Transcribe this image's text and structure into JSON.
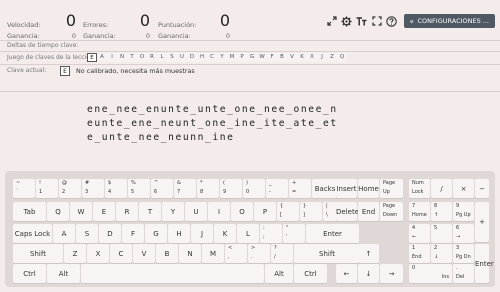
{
  "stats": {
    "speed_label": "Velocidad:",
    "speed_value": "0",
    "speed_gain_label": "Ganancia:",
    "speed_gain": "0",
    "errors_label": "Errores:",
    "errors_value": "0",
    "errors_gain_label": "Ganancia:",
    "errors_gain": "0",
    "score_label": "Puntuación:",
    "score_value": "0",
    "score_gain_label": "Ganancia:",
    "score_gain": "0"
  },
  "toolbar": {
    "config_label": "CONFIGURACIONES ..."
  },
  "info": {
    "delta_label": "Deltas de tiempo clave:",
    "lesson_keys_label": "Juego de claves de la lección:",
    "lesson_keys": [
      "E",
      "A",
      "I",
      "N",
      "T",
      "O",
      "R",
      "L",
      "S",
      "U",
      "D",
      "H",
      "C",
      "Y",
      "M",
      "P",
      "G",
      "W",
      "F",
      "B",
      "V",
      "K",
      "X",
      "J",
      "Z",
      "Q"
    ],
    "current_key_label": "Clave actual:",
    "current_key": "E",
    "current_msg": "No calibrado, necesita más muestras"
  },
  "practice": {
    "line1": "ene_nee_enunte_unte_one_nee_onee_n",
    "line2": "eunte_ene_neunt_one_ine_ite_ate_et",
    "line3": "e_unte_nee_neunn_ine"
  },
  "keyboard": {
    "row1": [
      [
        "~",
        "`"
      ],
      [
        "!",
        "1"
      ],
      [
        "@",
        "2"
      ],
      [
        "#",
        "3"
      ],
      [
        "$",
        "4"
      ],
      [
        "%",
        "5"
      ],
      [
        "^",
        "6"
      ],
      [
        "&",
        "7"
      ],
      [
        "*",
        "8"
      ],
      [
        "(",
        "9"
      ],
      [
        ")",
        "0"
      ],
      [
        "_",
        "-"
      ],
      [
        "+",
        "="
      ]
    ],
    "backspace": "Backspace",
    "tab": "Tab",
    "row2": [
      "Q",
      "W",
      "E",
      "R",
      "T",
      "Y",
      "U",
      "I",
      "O",
      "P"
    ],
    "row2_sym": [
      [
        "{",
        "["
      ],
      [
        "}",
        "]"
      ],
      [
        "|",
        "\\"
      ]
    ],
    "caps": "Caps Lock",
    "row3": [
      "A",
      "S",
      "D",
      "F",
      "G",
      "H",
      "J",
      "K",
      "L"
    ],
    "row3_sym": [
      [
        ":",
        ";"
      ],
      [
        "\"",
        "'"
      ]
    ],
    "enter": "Enter",
    "shift_l": "Shift",
    "row4": [
      "Z",
      "X",
      "C",
      "V",
      "B",
      "N",
      "M"
    ],
    "row4_sym": [
      [
        "<",
        ","
      ],
      [
        ">",
        "."
      ],
      [
        "?",
        "/"
      ]
    ],
    "shift_r": "Shift",
    "ctrl_l": "Ctrl",
    "alt_l": "Alt",
    "alt_r": "Alt",
    "ctrl_r": "Ctrl",
    "insert": "Insert",
    "home": "Home",
    "page_up_1": "Page",
    "page_up_2": "Up",
    "delete": "Delete",
    "end": "End",
    "page_down_1": "Page",
    "page_down_2": "Down",
    "arrow_up": "↑",
    "arrow_left": "←",
    "arrow_down": "↓",
    "arrow_right": "→",
    "numlock_1": "Num",
    "numlock_2": "Lock",
    "num_div": "/",
    "num_mul": "×",
    "num_sub": "−",
    "num_add": "+",
    "num_enter": "Enter",
    "num7": "7",
    "num7s": "Home",
    "num8": "8",
    "num8s": "↑",
    "num9": "9",
    "num9s": "Pg Up",
    "num4": "4",
    "num4s": "←",
    "num5": "5",
    "num6": "6",
    "num6s": "→",
    "num1": "1",
    "num1s": "End",
    "num2": "2",
    "num2s": "↓",
    "num3": "3",
    "num3s": "Pg Dn",
    "num0": "0",
    "num0s": "Ins",
    "numdot": ".",
    "numdots": "Del"
  }
}
